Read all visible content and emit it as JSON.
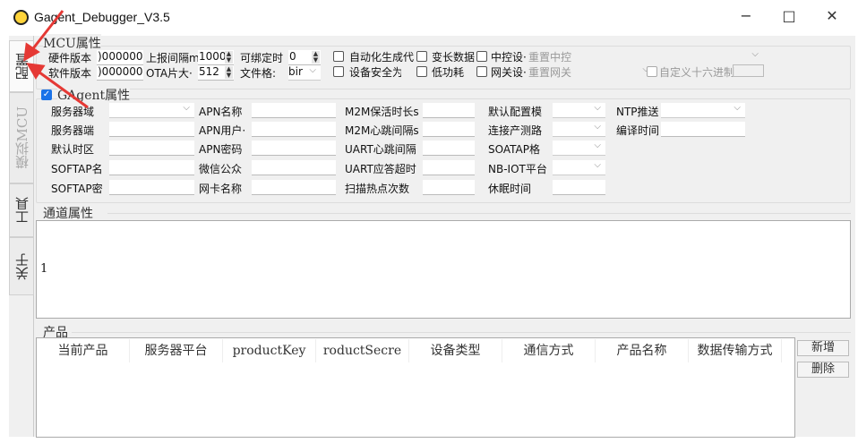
{
  "window": {
    "title": "Gagent_Debugger_V3.5",
    "minimize": "−",
    "maximize": "□",
    "close": "✕"
  },
  "tabs": [
    {
      "label": "配置"
    },
    {
      "label": "模拟MCU"
    },
    {
      "label": "工具"
    },
    {
      "label": "关于"
    }
  ],
  "mcu": {
    "title": "MCU属性",
    "hw_label": "硬件版本",
    "hw_value": ")0000000",
    "sw_label": "软件版本",
    "sw_value": ")0000000",
    "report_label": "上报间隔m",
    "report_value": "1000",
    "ota_label": "OTA片大·",
    "ota_value": "512",
    "bind_label": "可绑定时",
    "bind_value": "0",
    "file_label": "文件格:",
    "file_value": "bir",
    "auto_label": "自动化生成代",
    "secure_label": "设备安全为",
    "varlen_label": "变长数据",
    "lowpower_label": "低功耗",
    "ctrl_label": "中控设·",
    "ctrl_value": "重置中控",
    "gw_label": "网关设·",
    "gw_value": "重置网关",
    "hex_label": "自定义十六进制"
  },
  "gagent": {
    "title": "GAgent属性",
    "checked": true,
    "col1": [
      "服务器域",
      "服务器端",
      "默认时区",
      "SOFTAP名",
      "SOFTAP密"
    ],
    "col2": [
      "APN名称",
      "APN用户·",
      "APN密码",
      "微信公众",
      "网卡名称"
    ],
    "col3": [
      "M2M保活时长s",
      "M2M心跳间隔s",
      "UART心跳间隔",
      "UART应答超时",
      "扫描热点次数"
    ],
    "col4": [
      "默认配置模",
      "连接产测路",
      "SOATAP格",
      "NB-IOT平台",
      "休眠时间"
    ],
    "col5": [
      "NTP推送",
      "编译时间"
    ]
  },
  "channel": {
    "title": "通道属性",
    "line_number": "1"
  },
  "product": {
    "title": "产品",
    "columns": [
      "当前产品",
      "服务器平台",
      "productKey",
      "roductSecre",
      "设备类型",
      "通信方式",
      "产品名称",
      "数据传输方式"
    ],
    "add": "新增",
    "delete": "删除"
  },
  "colors": {
    "accent": "#1a73e8",
    "annotation": "#e53935"
  }
}
